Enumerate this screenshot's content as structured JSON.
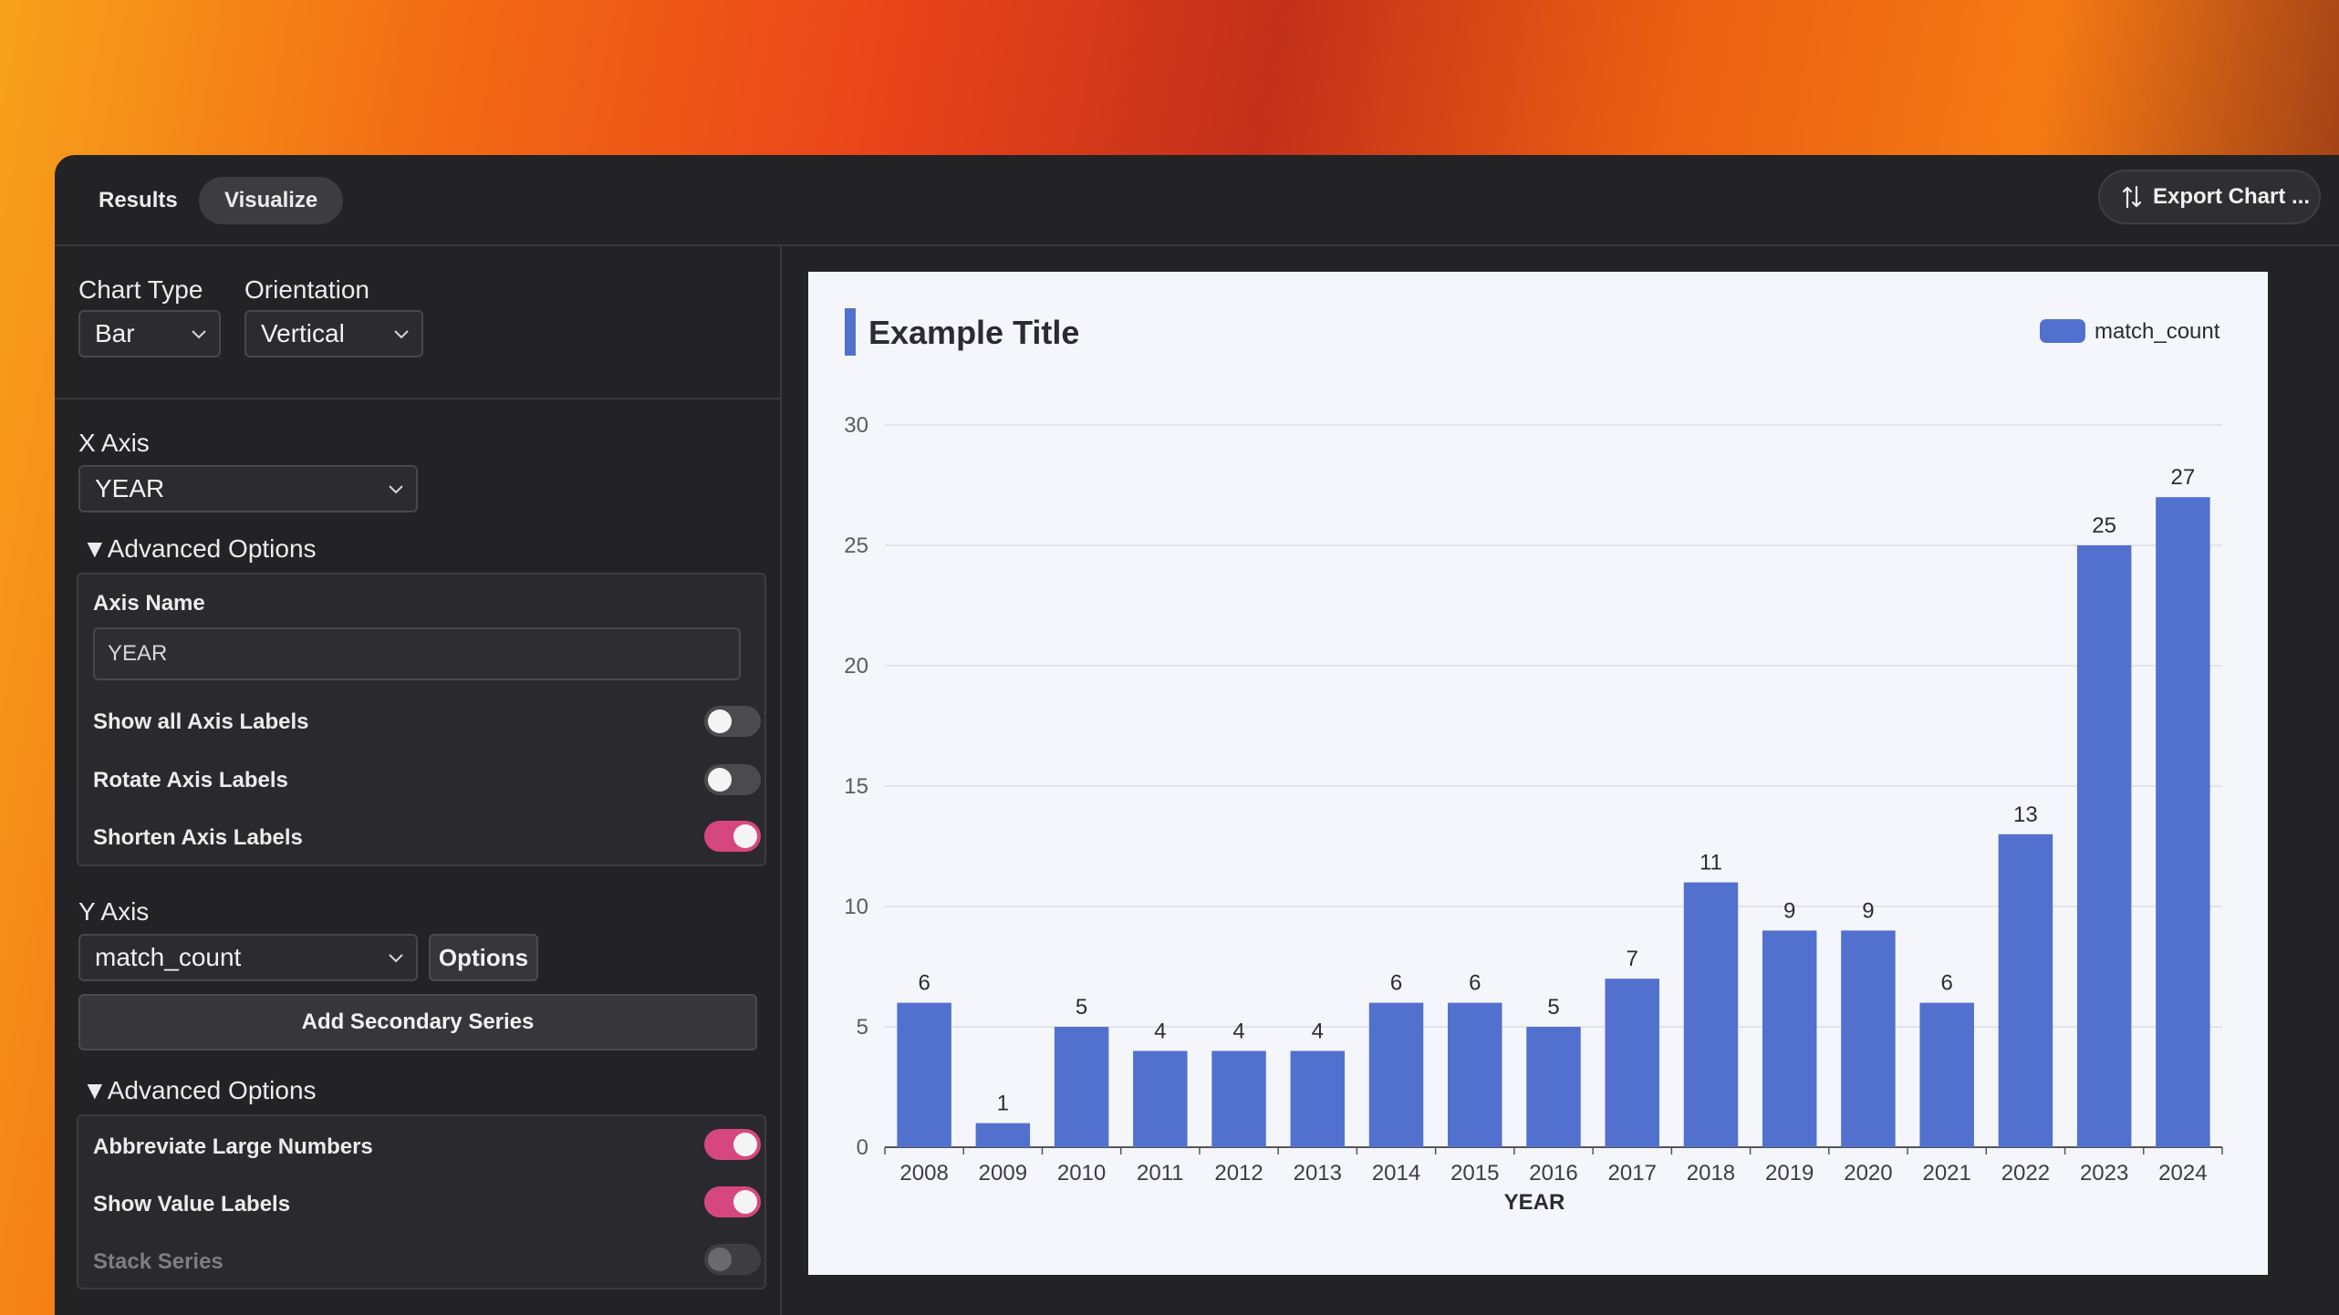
{
  "tabs": [
    {
      "label": "Results",
      "active": false
    },
    {
      "label": "Visualize",
      "active": true
    }
  ],
  "export_button": {
    "label": "Export Chart ...",
    "icon": "arrows-swap-icon"
  },
  "chart_type": {
    "label": "Chart Type",
    "value": "Bar"
  },
  "orientation": {
    "label": "Orientation",
    "value": "Vertical"
  },
  "x_axis": {
    "label": "X Axis",
    "value": "YEAR",
    "advanced_label": "Advanced Options",
    "axis_name_label": "Axis Name",
    "axis_name_value": "YEAR",
    "toggles": [
      {
        "label": "Show all Axis Labels",
        "on": false,
        "disabled": false
      },
      {
        "label": "Rotate Axis Labels",
        "on": false,
        "disabled": false
      },
      {
        "label": "Shorten Axis Labels",
        "on": true,
        "disabled": false
      }
    ]
  },
  "y_axis": {
    "label": "Y Axis",
    "value": "match_count",
    "options_label": "Options",
    "add_series_label": "Add Secondary Series",
    "advanced_label": "Advanced Options",
    "toggles": [
      {
        "label": "Abbreviate Large Numbers",
        "on": true,
        "disabled": false
      },
      {
        "label": "Show Value Labels",
        "on": true,
        "disabled": false
      },
      {
        "label": "Stack Series",
        "on": false,
        "disabled": true
      }
    ]
  },
  "colors": {
    "bar": "#5271cf",
    "toggle_on": "#d6487d",
    "title_accent": "#5271cf"
  },
  "chart_data": {
    "type": "bar",
    "title": "Example Title",
    "xlabel": "YEAR",
    "ylabel": "",
    "ylim": [
      0,
      30
    ],
    "yticks": [
      0,
      5,
      10,
      15,
      20,
      25,
      30
    ],
    "legend": "top-right",
    "grid": true,
    "show_value_labels": true,
    "categories": [
      "2008",
      "2009",
      "2010",
      "2011",
      "2012",
      "2013",
      "2014",
      "2015",
      "2016",
      "2017",
      "2018",
      "2019",
      "2020",
      "2021",
      "2022",
      "2023",
      "2024"
    ],
    "series": [
      {
        "name": "match_count",
        "values": [
          6,
          1,
          5,
          4,
          4,
          4,
          6,
          6,
          5,
          7,
          11,
          9,
          9,
          6,
          13,
          25,
          27
        ]
      }
    ]
  }
}
